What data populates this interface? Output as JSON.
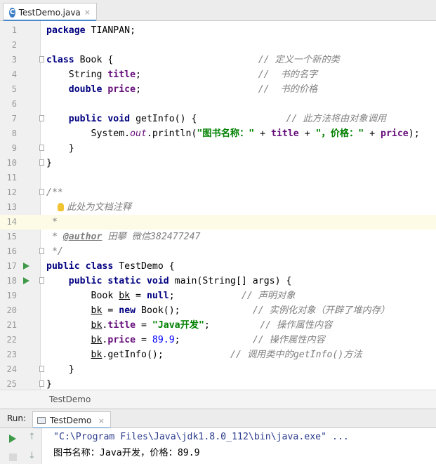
{
  "editor_tab": {
    "label": "TestDemo.java",
    "icon": "C",
    "close": "×"
  },
  "lines": [
    {
      "n": "1",
      "tokens": [
        {
          "t": "package",
          "c": "kw"
        },
        {
          "t": " TIANPAN;"
        }
      ]
    },
    {
      "n": "2",
      "tokens": []
    },
    {
      "n": "3",
      "tokens": [
        {
          "t": "class",
          "c": "kw"
        },
        {
          "t": " Book {                          "
        },
        {
          "t": "// 定义一个新的类",
          "c": "cm"
        }
      ]
    },
    {
      "n": "4",
      "tokens": [
        {
          "t": "    String "
        },
        {
          "t": "title",
          "c": "fld"
        },
        {
          "t": ";                     "
        },
        {
          "t": "//  书的名字",
          "c": "cm"
        }
      ]
    },
    {
      "n": "5",
      "tokens": [
        {
          "t": "    "
        },
        {
          "t": "double",
          "c": "kw"
        },
        {
          "t": " "
        },
        {
          "t": "price",
          "c": "fld"
        },
        {
          "t": ";                     "
        },
        {
          "t": "//  书的价格",
          "c": "cm"
        }
      ]
    },
    {
      "n": "6",
      "tokens": []
    },
    {
      "n": "7",
      "tokens": [
        {
          "t": "    "
        },
        {
          "t": "public",
          "c": "kw"
        },
        {
          "t": " "
        },
        {
          "t": "void",
          "c": "kw"
        },
        {
          "t": " getInfo() {                "
        },
        {
          "t": "// 此方法将由对象调用",
          "c": "cm"
        }
      ]
    },
    {
      "n": "8",
      "tokens": [
        {
          "t": "        System."
        },
        {
          "t": "out",
          "c": "st"
        },
        {
          "t": ".println("
        },
        {
          "t": "\"图书名称：\"",
          "c": "str"
        },
        {
          "t": " + "
        },
        {
          "t": "title",
          "c": "fld"
        },
        {
          "t": " + "
        },
        {
          "t": "\"，价格：\"",
          "c": "str"
        },
        {
          "t": " + "
        },
        {
          "t": "price",
          "c": "fld"
        },
        {
          "t": ");"
        }
      ]
    },
    {
      "n": "9",
      "tokens": [
        {
          "t": "    }"
        }
      ]
    },
    {
      "n": "10",
      "tokens": [
        {
          "t": "}"
        }
      ]
    },
    {
      "n": "11",
      "tokens": []
    },
    {
      "n": "12",
      "tokens": [
        {
          "t": "/**",
          "c": "cm"
        }
      ]
    },
    {
      "n": "13",
      "tokens": [
        {
          "t": "  ",
          "c": "cm"
        },
        {
          "t": "此处为文档注释",
          "c": "cm",
          "bulb": true
        }
      ]
    },
    {
      "n": "14",
      "tokens": [
        {
          "t": " *",
          "c": "cm"
        }
      ],
      "highlight": true
    },
    {
      "n": "15",
      "tokens": [
        {
          "t": " * ",
          "c": "cm"
        },
        {
          "t": "@author",
          "c": "tag"
        },
        {
          "t": " 田攀 微信382477247",
          "c": "cm"
        }
      ]
    },
    {
      "n": "16",
      "tokens": [
        {
          "t": " */",
          "c": "cm"
        }
      ]
    },
    {
      "n": "17",
      "tokens": [
        {
          "t": "public",
          "c": "kw"
        },
        {
          "t": " "
        },
        {
          "t": "class",
          "c": "kw"
        },
        {
          "t": " TestDemo {"
        }
      ],
      "run": true
    },
    {
      "n": "18",
      "tokens": [
        {
          "t": "    "
        },
        {
          "t": "public",
          "c": "kw"
        },
        {
          "t": " "
        },
        {
          "t": "static",
          "c": "kw"
        },
        {
          "t": " "
        },
        {
          "t": "void",
          "c": "kw"
        },
        {
          "t": " main(String[] args) {"
        }
      ],
      "run": true
    },
    {
      "n": "19",
      "tokens": [
        {
          "t": "        Book "
        },
        {
          "t": "bk",
          "c": "ul"
        },
        {
          "t": " = "
        },
        {
          "t": "null",
          "c": "kw"
        },
        {
          "t": ";            "
        },
        {
          "t": "// 声明对象",
          "c": "cm"
        }
      ]
    },
    {
      "n": "20",
      "tokens": [
        {
          "t": "        "
        },
        {
          "t": "bk",
          "c": "ul"
        },
        {
          "t": " = "
        },
        {
          "t": "new",
          "c": "kw"
        },
        {
          "t": " Book();             "
        },
        {
          "t": "// 实例化对象（开辟了堆内存）",
          "c": "cm"
        }
      ]
    },
    {
      "n": "21",
      "tokens": [
        {
          "t": "        "
        },
        {
          "t": "bk",
          "c": "ul"
        },
        {
          "t": "."
        },
        {
          "t": "title",
          "c": "fld"
        },
        {
          "t": " = "
        },
        {
          "t": "\"Java开发\"",
          "c": "str"
        },
        {
          "t": ";         "
        },
        {
          "t": "// 操作属性内容",
          "c": "cm"
        }
      ]
    },
    {
      "n": "22",
      "tokens": [
        {
          "t": "        "
        },
        {
          "t": "bk",
          "c": "ul"
        },
        {
          "t": "."
        },
        {
          "t": "price",
          "c": "fld"
        },
        {
          "t": " = "
        },
        {
          "t": "89.9",
          "c": "num"
        },
        {
          "t": ";             "
        },
        {
          "t": "// 操作属性内容",
          "c": "cm"
        }
      ]
    },
    {
      "n": "23",
      "tokens": [
        {
          "t": "        "
        },
        {
          "t": "bk",
          "c": "ul"
        },
        {
          "t": ".getInfo();            "
        },
        {
          "t": "// 调用类中的",
          "c": "cm"
        },
        {
          "t": "getInfo()",
          "c": "cm"
        },
        {
          "t": "方法",
          "c": "cm"
        }
      ]
    },
    {
      "n": "24",
      "tokens": [
        {
          "t": "    }"
        }
      ]
    },
    {
      "n": "25",
      "tokens": [
        {
          "t": "}"
        }
      ]
    }
  ],
  "fold_lines": [
    "3",
    "7",
    "9",
    "10",
    "12",
    "16",
    "18",
    "24",
    "25"
  ],
  "breadcrumb": "TestDemo",
  "run_panel": {
    "label": "Run:",
    "tab_label": "TestDemo",
    "close": "×"
  },
  "console": {
    "command": "\"C:\\Program Files\\Java\\jdk1.8.0_112\\bin\\java.exe\" ...",
    "output": "图书名称：Java开发，价格：89.9"
  }
}
